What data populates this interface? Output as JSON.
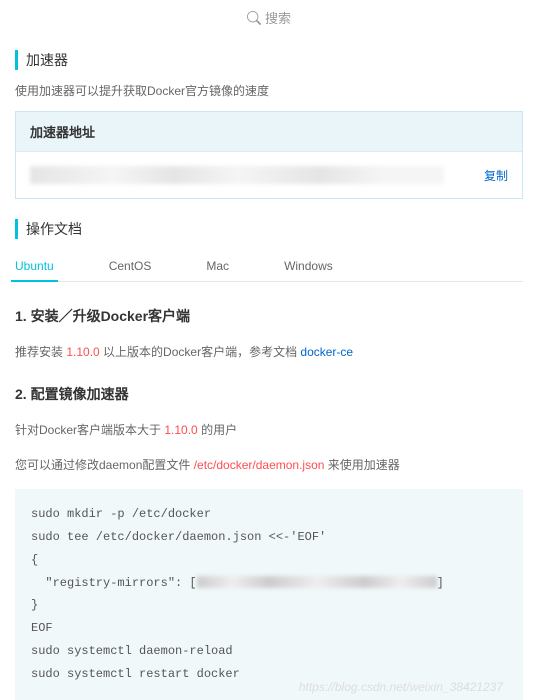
{
  "search": {
    "placeholder": "搜索"
  },
  "section1": {
    "title": "加速器",
    "desc": "使用加速器可以提升获取Docker官方镜像的速度",
    "box_header": "加速器地址",
    "copy": "复制"
  },
  "section2": {
    "title": "操作文档",
    "tabs": [
      "Ubuntu",
      "CentOS",
      "Mac",
      "Windows"
    ]
  },
  "step1": {
    "title": "1. 安装／升级Docker客户端",
    "pre": "推荐安装 ",
    "version": "1.10.0",
    "mid": " 以上版本的Docker客户端，参考文档 ",
    "link": "docker-ce"
  },
  "step2": {
    "title": "2. 配置镜像加速器",
    "line1_pre": "针对Docker客户端版本大于 ",
    "line1_ver": "1.10.0",
    "line1_post": " 的用户",
    "line2_pre": "您可以通过修改daemon配置文件 ",
    "line2_path": "/etc/docker/daemon.json",
    "line2_post": " 来使用加速器"
  },
  "code": {
    "l1": "sudo mkdir -p /etc/docker",
    "l2": "sudo tee /etc/docker/daemon.json <<-'EOF'",
    "l3": "{",
    "l4a": "  \"registry-mirrors\": [",
    "l4b": "]",
    "l5": "}",
    "l6": "EOF",
    "l7": "sudo systemctl daemon-reload",
    "l8": "sudo systemctl restart docker"
  },
  "watermark": "https://blog.csdn.net/weixin_38421237"
}
